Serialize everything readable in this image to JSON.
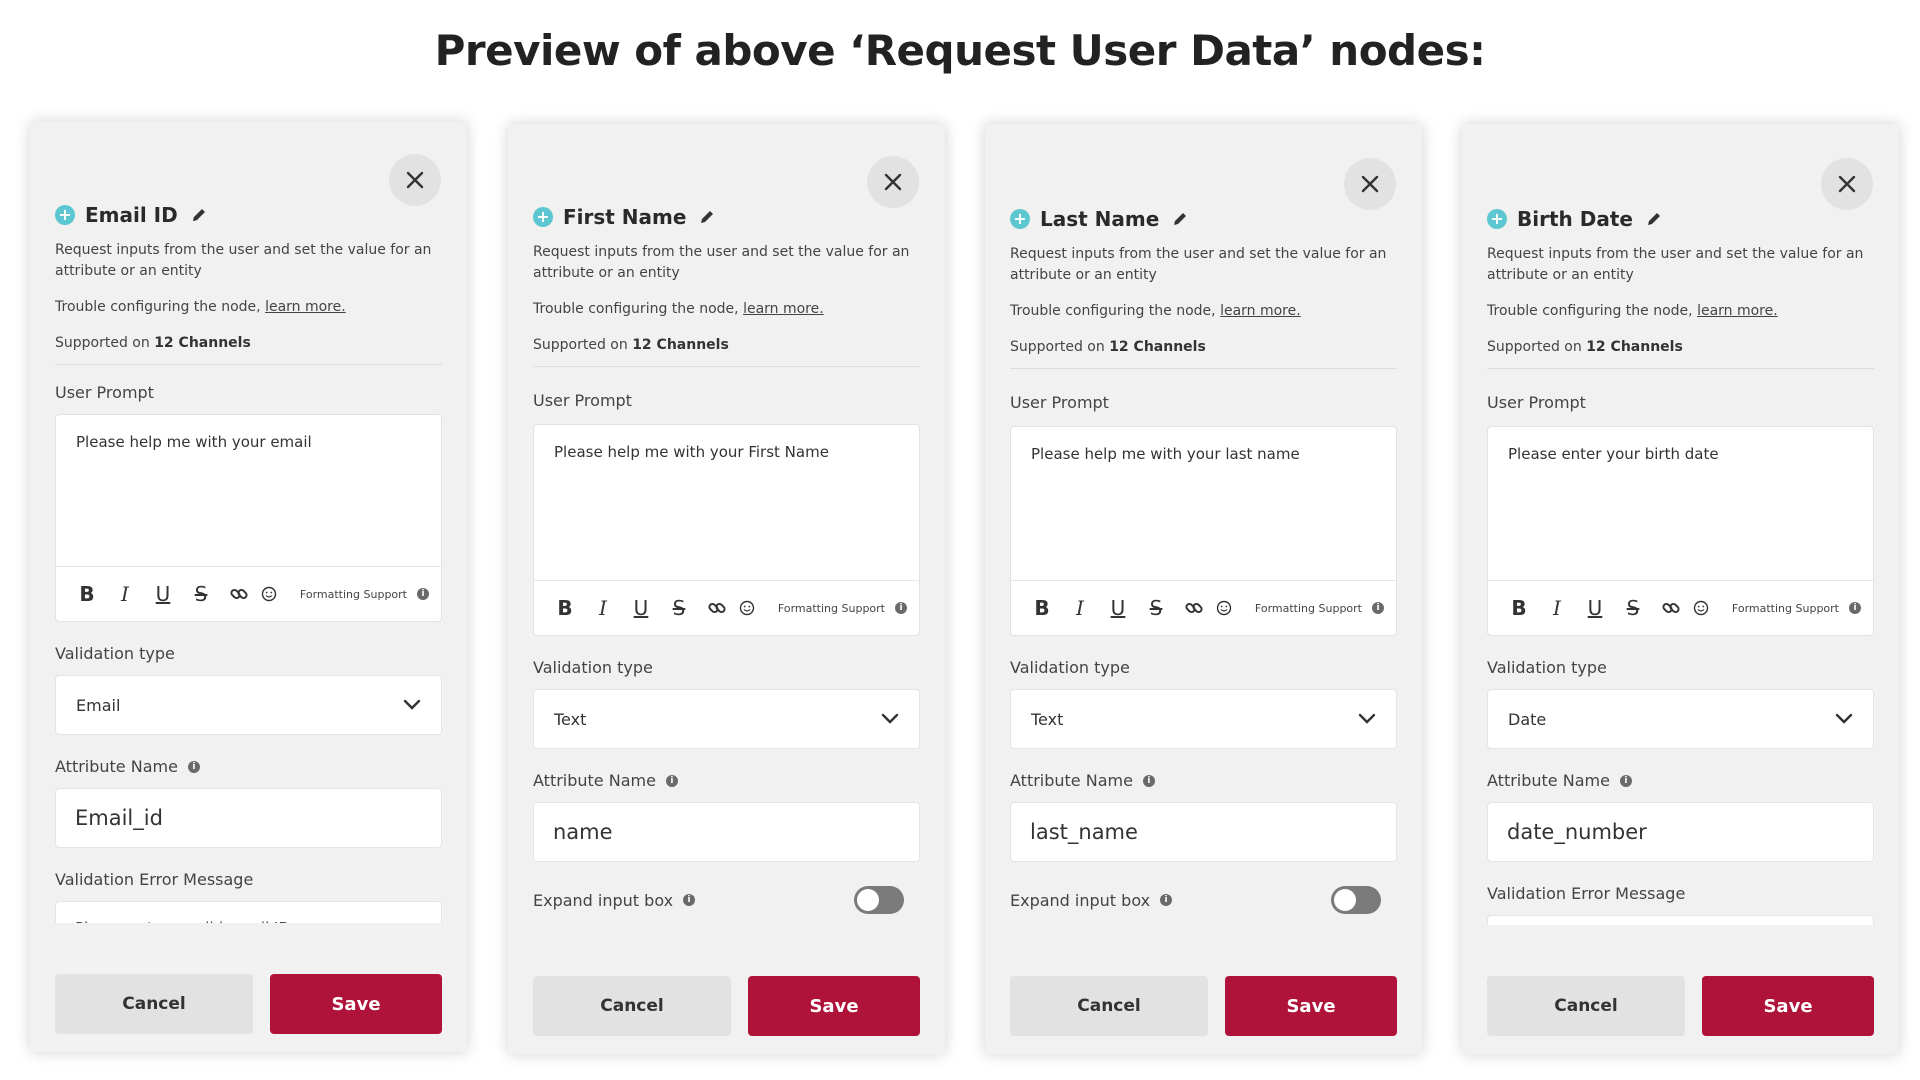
{
  "heading": "Preview of above ‘Request User Data’ nodes:",
  "common": {
    "description": "Request inputs from the user and set the value for an attribute or an entity",
    "trouble_prefix": "Trouble configuring the node,",
    "learn_more": "learn more.",
    "supported_prefix": "Supported on",
    "channels": "12 Channels",
    "user_prompt_label": "User Prompt",
    "formatting_support": "Formatting Support",
    "validation_type_label": "Validation type",
    "attribute_name_label": "Attribute Name",
    "validation_error_label": "Validation Error Message",
    "expand_input_label": "Expand input box",
    "cancel_label": "Cancel",
    "save_label": "Save"
  },
  "panels": [
    {
      "title": "Email ID",
      "prompt": "Please help me with your email",
      "validation_type": "Email",
      "attribute_name": "Email_id",
      "error_message_partial": "Please enter a valid email ID"
    },
    {
      "title": "First Name",
      "prompt": "Please help me with your First Name",
      "validation_type": "Text",
      "attribute_name": "name"
    },
    {
      "title": "Last Name",
      "prompt": "Please help me with your last name",
      "validation_type": "Text",
      "attribute_name": "last_name"
    },
    {
      "title": "Birth Date",
      "prompt": "Please enter your birth date",
      "validation_type": "Date",
      "attribute_name": "date_number"
    }
  ],
  "colors": {
    "save_button": "#b0133a",
    "node_icon": "#5cc7d1",
    "panel_bg": "#f2f1f1"
  },
  "icons": [
    "close-icon",
    "edit-pencil-icon",
    "node-plus-icon",
    "info-icon",
    "chevron-down-icon",
    "bold-icon",
    "italic-icon",
    "underline-icon",
    "strikethrough-icon",
    "link-icon",
    "emoji-icon"
  ]
}
